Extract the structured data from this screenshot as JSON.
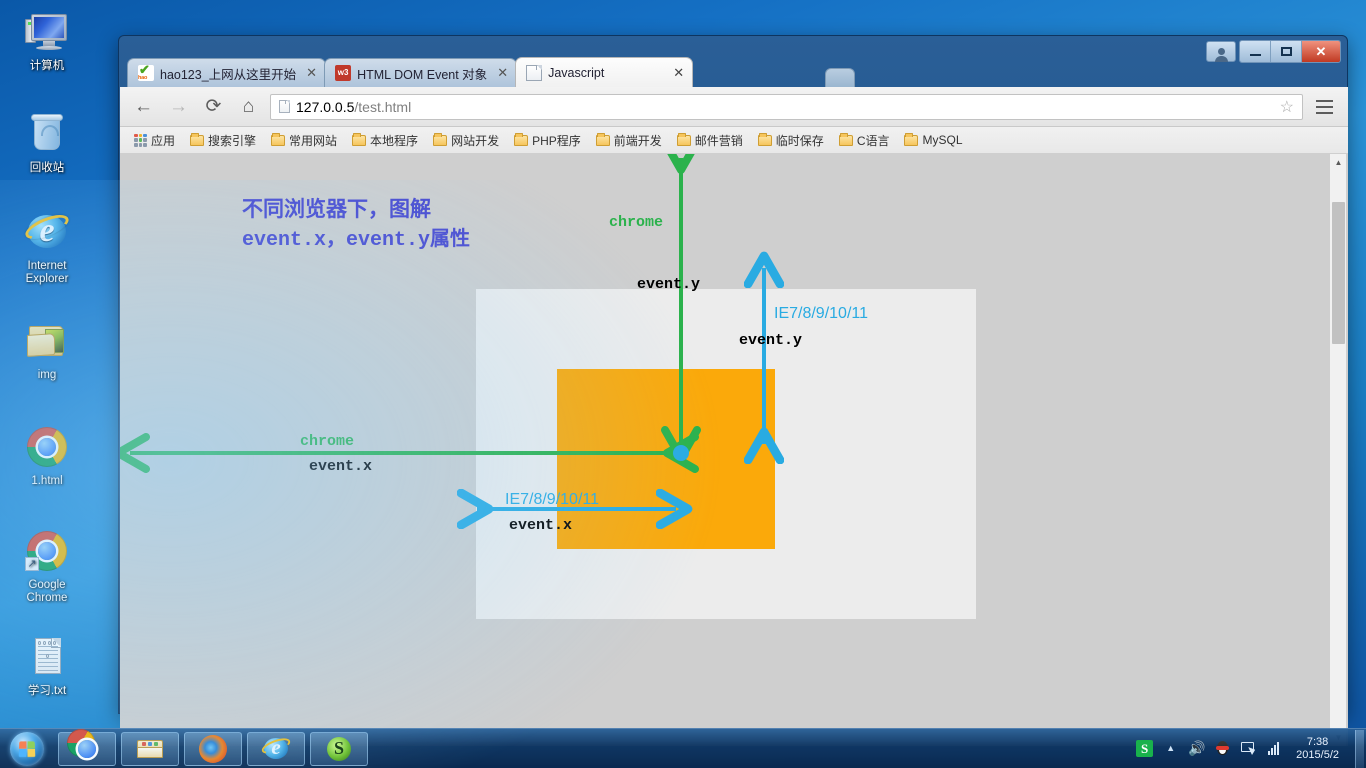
{
  "desktop": {
    "icons": [
      {
        "name": "computer",
        "label": "计算机"
      },
      {
        "name": "recycle-bin",
        "label": "回收站"
      },
      {
        "name": "internet-explorer",
        "label": "Internet\nExplorer",
        "line1": "Internet",
        "line2": "Explorer"
      },
      {
        "name": "img-folder",
        "label": "img"
      },
      {
        "name": "html-file",
        "label": "1.html"
      },
      {
        "name": "google-chrome",
        "label": "Google Chrome",
        "line1": "Google",
        "line2": "Chrome"
      },
      {
        "name": "text-file",
        "label": "学习.txt"
      }
    ]
  },
  "browser": {
    "tabs": [
      {
        "title": "hao123_上网从这里开始",
        "favicon": "hao123-icon",
        "active": false,
        "close": "✕"
      },
      {
        "title": "HTML DOM Event 对象",
        "favicon": "w3schools-icon",
        "active": false,
        "close": "✕"
      },
      {
        "title": "Javascript",
        "favicon": "document-icon",
        "active": true,
        "close": "✕"
      }
    ],
    "window_controls": {
      "user": "user-icon",
      "minimize": "−",
      "maximize": "□",
      "close": "✕"
    },
    "toolbar": {
      "back": "←",
      "forward": "→",
      "reload": "⟳",
      "home": "⌂",
      "url_host": "127.0.0.5",
      "url_path": "/test.html",
      "bookmark_star": "☆",
      "menu": "menu-icon"
    },
    "bookmarks": [
      {
        "label": "应用",
        "icon": "apps-grid-icon"
      },
      {
        "label": "搜索引擎",
        "icon": "folder-icon"
      },
      {
        "label": "常用网站",
        "icon": "folder-icon"
      },
      {
        "label": "本地程序",
        "icon": "folder-icon"
      },
      {
        "label": "网站开发",
        "icon": "folder-icon"
      },
      {
        "label": "PHP程序",
        "icon": "folder-icon"
      },
      {
        "label": "前端开发",
        "icon": "folder-icon"
      },
      {
        "label": "邮件营销",
        "icon": "folder-icon"
      },
      {
        "label": "临时保存",
        "icon": "folder-icon"
      },
      {
        "label": "C语言",
        "icon": "folder-icon"
      },
      {
        "label": "MySQL",
        "icon": "folder-icon"
      }
    ],
    "scrollbar": {
      "up": "▲",
      "down": "▼"
    }
  },
  "page": {
    "heading_line1": "不同浏览器下，图解",
    "heading_line2": "event.x，event.y属性",
    "heading_color": "#4a4ad0",
    "outer_box_color": "#ececec",
    "inner_box_color": "#fba90a",
    "chrome_color": "#2bb24c",
    "ie_color": "#29abe2",
    "labels": {
      "chrome_y_browser": "chrome",
      "chrome_y_prop": "event.y",
      "ie_y_browser": "IE7/8/9/10/11",
      "ie_y_prop": "event.y",
      "chrome_x_browser": "chrome",
      "chrome_x_prop": "event.x",
      "ie_x_browser": "IE7/8/9/10/11",
      "ie_x_prop": "event.x"
    }
  },
  "taskbar": {
    "start": "start-orb",
    "buttons": [
      {
        "name": "chrome",
        "icon": "chrome-icon"
      },
      {
        "name": "explorer",
        "icon": "file-explorer-icon"
      },
      {
        "name": "firefox",
        "icon": "firefox-icon"
      },
      {
        "name": "internet-explorer",
        "icon": "ie-icon"
      },
      {
        "name": "sogou",
        "icon": "sogou-icon"
      }
    ],
    "tray": {
      "ime": "S",
      "overflow": "▲",
      "volume": "🔊",
      "qq": "qq-icon",
      "monitor": "monitor-icon",
      "network": "network-icon",
      "time": "7:38",
      "date": "2015/5/2"
    }
  }
}
